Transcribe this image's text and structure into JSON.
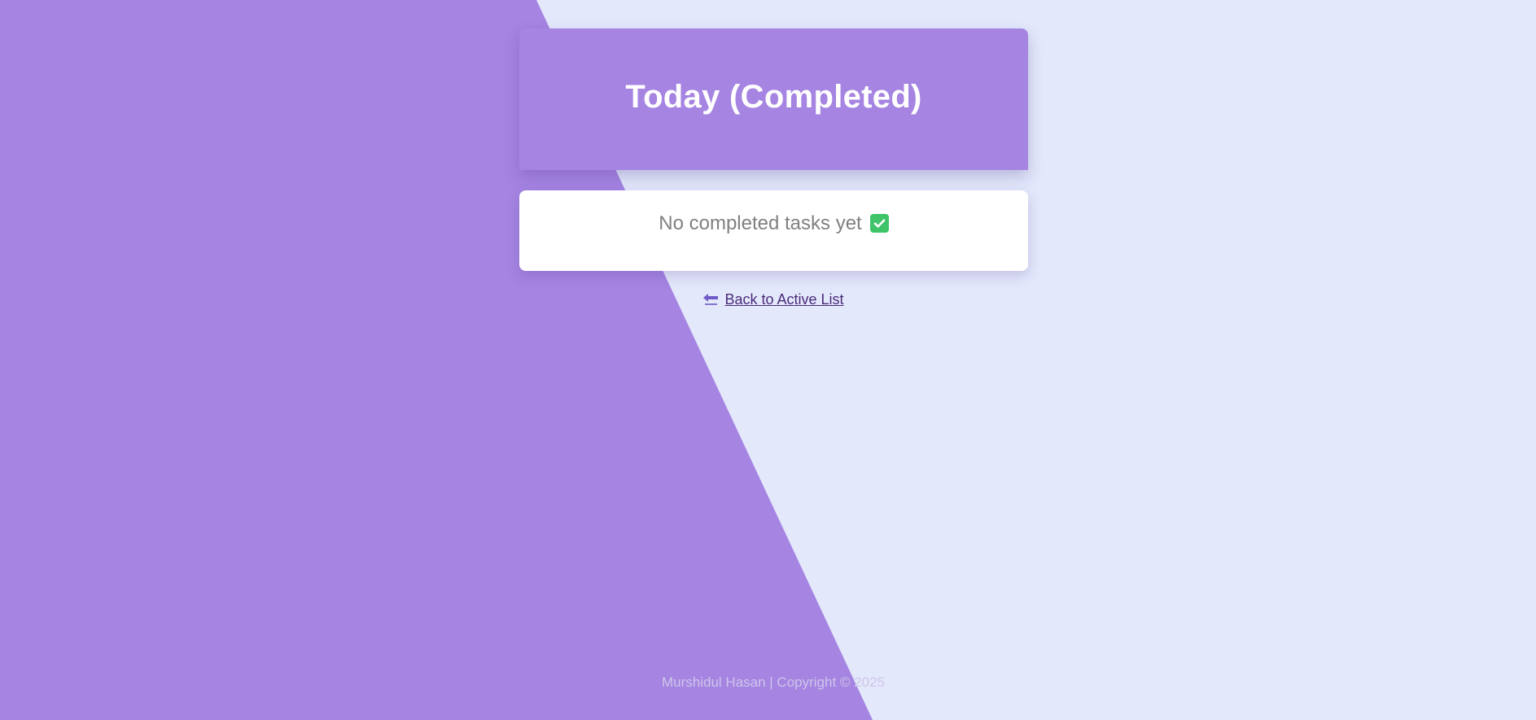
{
  "colors": {
    "background": "#e3e8fb",
    "accent_purple": "#a584e2",
    "card": "#ffffff",
    "link": "#4b2a7a",
    "check_green": "#3fc46a"
  },
  "header": {
    "title": "Today (Completed)"
  },
  "empty_state": {
    "message": "No completed tasks yet",
    "icon": "check-mark-icon"
  },
  "back_link": {
    "label": "Back to Active List",
    "icon": "back-arrow-icon"
  },
  "footer": {
    "text": "Murshidul Hasan | Copyright © 2025"
  }
}
